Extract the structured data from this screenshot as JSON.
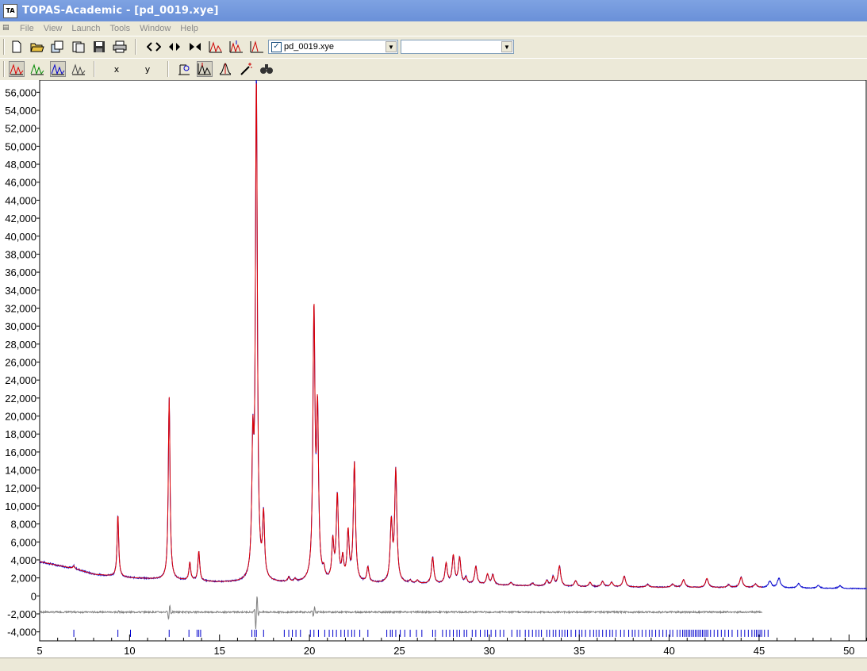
{
  "window": {
    "title": "TOPAS-Academic - [pd_0019.xye]",
    "icon": "topas-app-icon"
  },
  "menu": {
    "items": [
      "File",
      "View",
      "Launch",
      "Tools",
      "Window",
      "Help"
    ]
  },
  "toolbar1": {
    "icons": [
      "new-file-icon",
      "open-folder-icon",
      "open-multiple-icon",
      "copy-pages-icon",
      "save-icon",
      "print-icon",
      "zoom-fit-width-icon",
      "zoom-in-x-icon",
      "zoom-out-x-icon",
      "peak-fit-icon",
      "peak-tick-icon",
      "peak-select-icon"
    ],
    "file_combo": {
      "value": "pd_0019.xye",
      "checked": true
    },
    "second_combo": {
      "value": ""
    }
  },
  "toolbar2": {
    "icons": [
      "observed-pattern-red-icon",
      "calculated-pattern-green-icon",
      "difference-pattern-blue-icon",
      "background-pattern-icon",
      "scale-icon",
      "peak-position-icon",
      "single-peak-icon",
      "magic-wand-icon",
      "binoculars-icon"
    ],
    "x_label": "x",
    "y_label": "y"
  },
  "colors": {
    "observed": "#0000cc",
    "calculated": "#e00000",
    "difference": "#808080",
    "ticks": "#0000cc"
  },
  "chart_data": {
    "type": "line",
    "title": "",
    "xlabel": "",
    "ylabel": "",
    "xlim": [
      5,
      51
    ],
    "ylim": [
      -5000,
      57000
    ],
    "grid": false,
    "x_ticks": [
      5,
      10,
      15,
      20,
      25,
      30,
      35,
      40,
      45,
      50
    ],
    "y_ticks": [
      -4000,
      -2000,
      0,
      2000,
      4000,
      6000,
      8000,
      10000,
      12000,
      14000,
      16000,
      18000,
      20000,
      22000,
      24000,
      26000,
      28000,
      30000,
      32000,
      34000,
      36000,
      38000,
      40000,
      42000,
      44000,
      46000,
      48000,
      50000,
      52000,
      54000,
      56000
    ],
    "y_tick_labels": [
      "-4,000",
      "-2,000",
      "0",
      "2,000",
      "4,000",
      "6,000",
      "8,000",
      "10,000",
      "12,000",
      "14,000",
      "16,000",
      "18,000",
      "20,000",
      "22,000",
      "24,000",
      "26,000",
      "28,000",
      "30,000",
      "32,000",
      "34,000",
      "36,000",
      "38,000",
      "40,000",
      "42,000",
      "44,000",
      "46,000",
      "48,000",
      "50,000",
      "52,000",
      "54,000",
      "56,000"
    ],
    "background": [
      [
        5,
        3800
      ],
      [
        7,
        3000
      ],
      [
        8,
        2400
      ],
      [
        10,
        2000
      ],
      [
        12,
        1800
      ],
      [
        15,
        1500
      ],
      [
        20,
        1400
      ],
      [
        25,
        1350
      ],
      [
        30,
        1200
      ],
      [
        35,
        1000
      ],
      [
        40,
        950
      ],
      [
        45,
        900
      ],
      [
        51,
        800
      ]
    ],
    "peaks": [
      {
        "x": 6.9,
        "h": 300
      },
      {
        "x": 9.35,
        "h": 6900
      },
      {
        "x": 12.2,
        "h": 20300
      },
      {
        "x": 13.35,
        "h": 2000
      },
      {
        "x": 13.85,
        "h": 3300
      },
      {
        "x": 16.85,
        "h": 13500
      },
      {
        "x": 17.05,
        "h": 55400
      },
      {
        "x": 17.45,
        "h": 6900
      },
      {
        "x": 18.85,
        "h": 500
      },
      {
        "x": 19.2,
        "h": 300
      },
      {
        "x": 20.25,
        "h": 29600
      },
      {
        "x": 20.45,
        "h": 18000
      },
      {
        "x": 20.8,
        "h": 1000
      },
      {
        "x": 21.3,
        "h": 4300
      },
      {
        "x": 21.55,
        "h": 9500
      },
      {
        "x": 21.85,
        "h": 2400
      },
      {
        "x": 22.15,
        "h": 5400
      },
      {
        "x": 22.5,
        "h": 13200
      },
      {
        "x": 23.25,
        "h": 1700
      },
      {
        "x": 24.55,
        "h": 6500
      },
      {
        "x": 24.8,
        "h": 12400
      },
      {
        "x": 25.6,
        "h": 300
      },
      {
        "x": 26.0,
        "h": 350
      },
      {
        "x": 26.85,
        "h": 2950
      },
      {
        "x": 27.6,
        "h": 2250
      },
      {
        "x": 28.0,
        "h": 3100
      },
      {
        "x": 28.35,
        "h": 2900
      },
      {
        "x": 28.7,
        "h": 700
      },
      {
        "x": 29.25,
        "h": 2000
      },
      {
        "x": 29.9,
        "h": 1150
      },
      {
        "x": 30.2,
        "h": 1100
      },
      {
        "x": 31.2,
        "h": 300
      },
      {
        "x": 32.4,
        "h": 300
      },
      {
        "x": 33.2,
        "h": 600
      },
      {
        "x": 33.55,
        "h": 1000
      },
      {
        "x": 33.9,
        "h": 2200
      },
      {
        "x": 34.8,
        "h": 650
      },
      {
        "x": 35.6,
        "h": 500
      },
      {
        "x": 36.3,
        "h": 600
      },
      {
        "x": 36.8,
        "h": 500
      },
      {
        "x": 37.5,
        "h": 1200
      },
      {
        "x": 38.8,
        "h": 300
      },
      {
        "x": 40.2,
        "h": 350
      },
      {
        "x": 40.8,
        "h": 850
      },
      {
        "x": 42.1,
        "h": 1000
      },
      {
        "x": 43.3,
        "h": 300
      },
      {
        "x": 44.0,
        "h": 1150
      },
      {
        "x": 44.8,
        "h": 400
      },
      {
        "x": 45.6,
        "h": 750
      },
      {
        "x": 46.1,
        "h": 1050
      },
      {
        "x": 47.2,
        "h": 500
      },
      {
        "x": 48.3,
        "h": 300
      },
      {
        "x": 49.5,
        "h": 300
      }
    ],
    "calc_end_x": 45.2,
    "difference_offset": -1800,
    "difference_features": [
      {
        "x": 12.2,
        "amp": 1000
      },
      {
        "x": 17.05,
        "amp": 2300
      },
      {
        "x": 20.25,
        "amp": 600
      },
      {
        "x": 9.35,
        "amp": 200
      }
    ],
    "tick_row_y": -4200,
    "hkl_ticks": [
      6.9,
      9.35,
      10.05,
      12.2,
      13.3,
      13.75,
      13.85,
      13.95,
      16.8,
      16.95,
      17.05,
      17.45,
      18.6,
      18.85,
      19.05,
      19.25,
      19.5,
      20.05,
      20.25,
      20.5,
      20.85,
      21.1,
      21.3,
      21.5,
      21.75,
      21.95,
      22.15,
      22.35,
      22.5,
      22.8,
      23.25,
      24.3,
      24.5,
      24.6,
      24.8,
      25.05,
      25.3,
      25.6,
      25.95,
      26.25,
      26.85,
      27.0,
      27.4,
      27.6,
      27.8,
      28.0,
      28.2,
      28.35,
      28.6,
      28.75,
      29.05,
      29.25,
      29.5,
      29.75,
      29.9,
      30.1,
      30.35,
      30.6,
      30.8,
      31.25,
      31.55,
      31.7,
      32.0,
      32.2,
      32.4,
      32.6,
      32.75,
      32.9,
      33.2,
      33.35,
      33.55,
      33.7,
      33.9,
      34.05,
      34.2,
      34.35,
      34.55,
      34.8,
      35.0,
      35.15,
      35.35,
      35.6,
      35.8,
      35.95,
      36.1,
      36.3,
      36.5,
      36.7,
      36.85,
      37.05,
      37.3,
      37.5,
      37.75,
      37.95,
      38.1,
      38.3,
      38.5,
      38.7,
      38.9,
      39.05,
      39.25,
      39.45,
      39.65,
      39.85,
      40.05,
      40.2,
      40.45,
      40.6,
      40.75,
      40.85,
      40.95,
      41.05,
      41.15,
      41.25,
      41.35,
      41.45,
      41.55,
      41.65,
      41.75,
      41.85,
      41.95,
      42.05,
      42.15,
      42.3,
      42.5,
      42.7,
      42.9,
      43.1,
      43.3,
      43.5,
      43.8,
      44.0,
      44.2,
      44.4,
      44.6,
      44.75,
      44.85,
      44.95,
      45.05,
      45.15,
      45.3,
      45.5
    ]
  }
}
